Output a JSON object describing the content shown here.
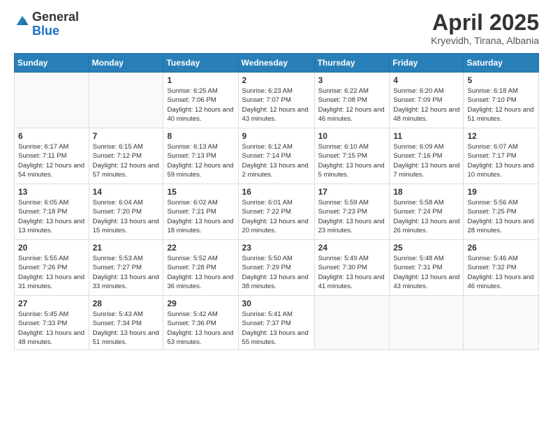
{
  "logo": {
    "general": "General",
    "blue": "Blue"
  },
  "title": "April 2025",
  "subtitle": "Kryevidh, Tirana, Albania",
  "weekdays": [
    "Sunday",
    "Monday",
    "Tuesday",
    "Wednesday",
    "Thursday",
    "Friday",
    "Saturday"
  ],
  "weeks": [
    [
      {
        "day": "",
        "info": ""
      },
      {
        "day": "",
        "info": ""
      },
      {
        "day": "1",
        "info": "Sunrise: 6:25 AM\nSunset: 7:06 PM\nDaylight: 12 hours and 40 minutes."
      },
      {
        "day": "2",
        "info": "Sunrise: 6:23 AM\nSunset: 7:07 PM\nDaylight: 12 hours and 43 minutes."
      },
      {
        "day": "3",
        "info": "Sunrise: 6:22 AM\nSunset: 7:08 PM\nDaylight: 12 hours and 46 minutes."
      },
      {
        "day": "4",
        "info": "Sunrise: 6:20 AM\nSunset: 7:09 PM\nDaylight: 12 hours and 48 minutes."
      },
      {
        "day": "5",
        "info": "Sunrise: 6:18 AM\nSunset: 7:10 PM\nDaylight: 12 hours and 51 minutes."
      }
    ],
    [
      {
        "day": "6",
        "info": "Sunrise: 6:17 AM\nSunset: 7:11 PM\nDaylight: 12 hours and 54 minutes."
      },
      {
        "day": "7",
        "info": "Sunrise: 6:15 AM\nSunset: 7:12 PM\nDaylight: 12 hours and 57 minutes."
      },
      {
        "day": "8",
        "info": "Sunrise: 6:13 AM\nSunset: 7:13 PM\nDaylight: 12 hours and 59 minutes."
      },
      {
        "day": "9",
        "info": "Sunrise: 6:12 AM\nSunset: 7:14 PM\nDaylight: 13 hours and 2 minutes."
      },
      {
        "day": "10",
        "info": "Sunrise: 6:10 AM\nSunset: 7:15 PM\nDaylight: 13 hours and 5 minutes."
      },
      {
        "day": "11",
        "info": "Sunrise: 6:09 AM\nSunset: 7:16 PM\nDaylight: 13 hours and 7 minutes."
      },
      {
        "day": "12",
        "info": "Sunrise: 6:07 AM\nSunset: 7:17 PM\nDaylight: 13 hours and 10 minutes."
      }
    ],
    [
      {
        "day": "13",
        "info": "Sunrise: 6:05 AM\nSunset: 7:18 PM\nDaylight: 13 hours and 13 minutes."
      },
      {
        "day": "14",
        "info": "Sunrise: 6:04 AM\nSunset: 7:20 PM\nDaylight: 13 hours and 15 minutes."
      },
      {
        "day": "15",
        "info": "Sunrise: 6:02 AM\nSunset: 7:21 PM\nDaylight: 13 hours and 18 minutes."
      },
      {
        "day": "16",
        "info": "Sunrise: 6:01 AM\nSunset: 7:22 PM\nDaylight: 13 hours and 20 minutes."
      },
      {
        "day": "17",
        "info": "Sunrise: 5:59 AM\nSunset: 7:23 PM\nDaylight: 13 hours and 23 minutes."
      },
      {
        "day": "18",
        "info": "Sunrise: 5:58 AM\nSunset: 7:24 PM\nDaylight: 13 hours and 26 minutes."
      },
      {
        "day": "19",
        "info": "Sunrise: 5:56 AM\nSunset: 7:25 PM\nDaylight: 13 hours and 28 minutes."
      }
    ],
    [
      {
        "day": "20",
        "info": "Sunrise: 5:55 AM\nSunset: 7:26 PM\nDaylight: 13 hours and 31 minutes."
      },
      {
        "day": "21",
        "info": "Sunrise: 5:53 AM\nSunset: 7:27 PM\nDaylight: 13 hours and 33 minutes."
      },
      {
        "day": "22",
        "info": "Sunrise: 5:52 AM\nSunset: 7:28 PM\nDaylight: 13 hours and 36 minutes."
      },
      {
        "day": "23",
        "info": "Sunrise: 5:50 AM\nSunset: 7:29 PM\nDaylight: 13 hours and 38 minutes."
      },
      {
        "day": "24",
        "info": "Sunrise: 5:49 AM\nSunset: 7:30 PM\nDaylight: 13 hours and 41 minutes."
      },
      {
        "day": "25",
        "info": "Sunrise: 5:48 AM\nSunset: 7:31 PM\nDaylight: 13 hours and 43 minutes."
      },
      {
        "day": "26",
        "info": "Sunrise: 5:46 AM\nSunset: 7:32 PM\nDaylight: 13 hours and 46 minutes."
      }
    ],
    [
      {
        "day": "27",
        "info": "Sunrise: 5:45 AM\nSunset: 7:33 PM\nDaylight: 13 hours and 48 minutes."
      },
      {
        "day": "28",
        "info": "Sunrise: 5:43 AM\nSunset: 7:34 PM\nDaylight: 13 hours and 51 minutes."
      },
      {
        "day": "29",
        "info": "Sunrise: 5:42 AM\nSunset: 7:36 PM\nDaylight: 13 hours and 53 minutes."
      },
      {
        "day": "30",
        "info": "Sunrise: 5:41 AM\nSunset: 7:37 PM\nDaylight: 13 hours and 55 minutes."
      },
      {
        "day": "",
        "info": ""
      },
      {
        "day": "",
        "info": ""
      },
      {
        "day": "",
        "info": ""
      }
    ]
  ]
}
